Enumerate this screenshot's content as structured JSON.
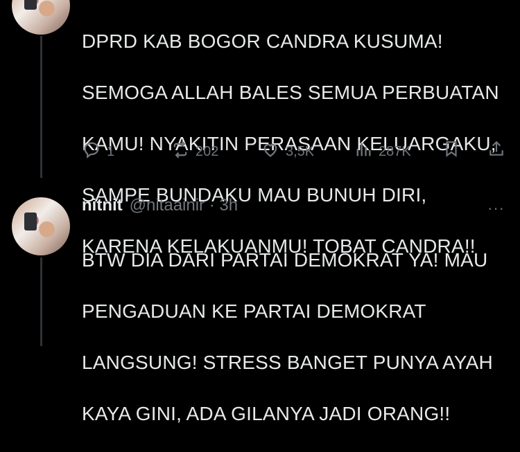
{
  "tweet1": {
    "text_lines": [
      "DPRD KAB BOGOR CANDRA KUSUMA!",
      "SEMOGA ALLAH BALES SEMUA PERBUATAN",
      "KAMU! NYAKITIN PERASAAN KELUARGAKU,",
      "SAMPE BUNDAKU MAU BUNUH DIRI,",
      "KARENA KELAKUANMU! TOBAT CANDRA!!"
    ],
    "actions": {
      "replies": "1",
      "retweets": "202",
      "likes": "3,5K",
      "views": "287K"
    }
  },
  "tweet2": {
    "name": "nitnit",
    "handle": "@nitaainir · 3h",
    "more": "···",
    "text_lines": [
      "BTW DIA DARI PARTAI DEMOKRAT YA! MAU",
      "PENGADUAN KE PARTAI DEMOKRAT",
      "LANGSUNG! STRESS BANGET PUNYA AYAH",
      "KAYA GINI, ADA GILANYA JADI ORANG!!"
    ]
  },
  "colors": {
    "background": "#000000",
    "text": "#e7e9ea",
    "muted": "#71767b",
    "thread_line": "#2f3336"
  },
  "icons": [
    "reply-icon",
    "retweet-icon",
    "like-icon",
    "views-icon",
    "bookmark-icon",
    "share-icon",
    "more-icon"
  ]
}
